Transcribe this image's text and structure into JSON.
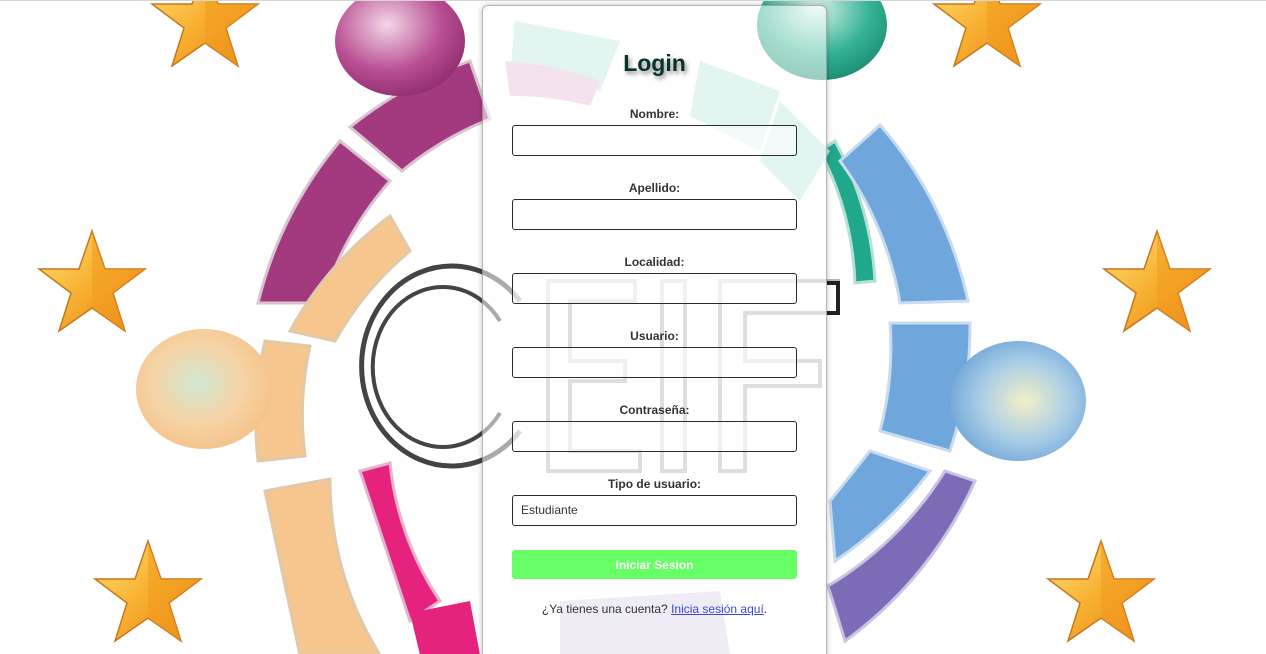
{
  "title": "Login",
  "fields": {
    "nombre": {
      "label": "Nombre:",
      "value": ""
    },
    "apellido": {
      "label": "Apellido:",
      "value": ""
    },
    "localidad": {
      "label": "Localidad:",
      "value": ""
    },
    "usuario": {
      "label": "Usuario:",
      "value": ""
    },
    "contrasena": {
      "label": "Contraseña:",
      "value": ""
    },
    "tipo_usuario": {
      "label": "Tipo de usuario:",
      "selected": "Estudiante"
    }
  },
  "submit_label": "Iniciar Sesion",
  "footer": {
    "prompt": "¿Ya tienes una cuenta? ",
    "link_text": "Inicia sesión aquí",
    "suffix": "."
  },
  "background": {
    "logo_text": "CEIF",
    "colors": {
      "purple": "#a3397f",
      "teal": "#1fa88b",
      "blue": "#6fa6dc",
      "orange": "#f7c68f",
      "pink": "#e6227f",
      "violet": "#7d6bb8",
      "star": "#f5a623",
      "button_green": "#66ff66",
      "title_dark_green": "#07332c"
    }
  }
}
